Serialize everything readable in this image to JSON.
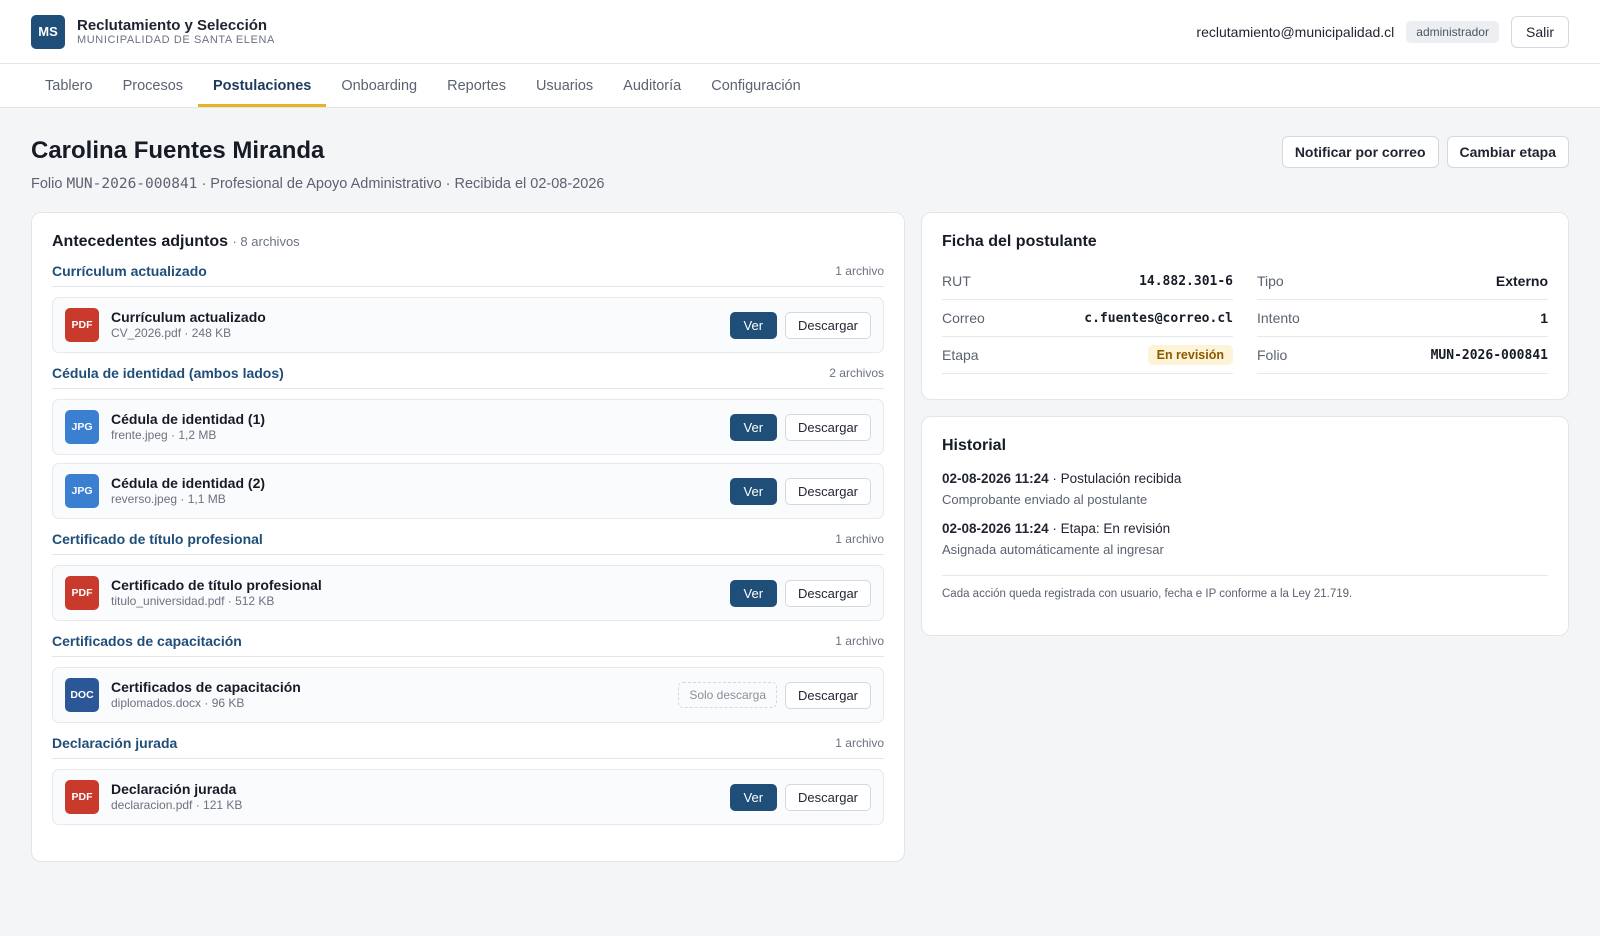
{
  "header": {
    "logo_text": "MS",
    "title": "Reclutamiento y Selección",
    "subtitle": "MUNICIPALIDAD DE SANTA ELENA",
    "user_email": "reclutamiento@municipalidad.cl",
    "role": "administrador",
    "logout_label": "Salir"
  },
  "nav": {
    "items": [
      "Tablero",
      "Procesos",
      "Postulaciones",
      "Onboarding",
      "Reportes",
      "Usuarios",
      "Auditoría",
      "Configuración"
    ],
    "active": "Postulaciones"
  },
  "page": {
    "title": "Carolina Fuentes Miranda",
    "meta_prefix": "Folio",
    "folio": "MUN-2026-000841",
    "meta_rest": "· Profesional de Apoyo Administrativo · Recibida el 02-08-2026",
    "actions": {
      "notify": "Notificar por correo",
      "change_stage": "Cambiar etapa"
    }
  },
  "attachments": {
    "title": "Antecedentes adjuntos",
    "count": "· 8 archivos",
    "view_label": "Ver",
    "download_label": "Descargar",
    "only_download_label": "Solo descarga",
    "groups": [
      {
        "name": "Currículum actualizado",
        "count": "1 archivo",
        "files": [
          {
            "type": "PDF",
            "color": "#c9392c",
            "name": "Currículum actualizado",
            "sub": "CV_2026.pdf · 248 KB",
            "viewable": true
          }
        ]
      },
      {
        "name": "Cédula de identidad (ambos lados)",
        "count": "2 archivos",
        "files": [
          {
            "type": "JPG",
            "color": "#3a7fd0",
            "name": "Cédula de identidad (1)",
            "sub": "frente.jpeg · 1,2 MB",
            "viewable": true
          },
          {
            "type": "JPG",
            "color": "#3a7fd0",
            "name": "Cédula de identidad (2)",
            "sub": "reverso.jpeg · 1,1 MB",
            "viewable": true
          }
        ]
      },
      {
        "name": "Certificado de título profesional",
        "count": "1 archivo",
        "files": [
          {
            "type": "PDF",
            "color": "#c9392c",
            "name": "Certificado de título profesional",
            "sub": "titulo_universidad.pdf · 512 KB",
            "viewable": true
          }
        ]
      },
      {
        "name": "Certificados de capacitación",
        "count": "1 archivo",
        "files": [
          {
            "type": "DOC",
            "color": "#2b5797",
            "name": "Certificados de capacitación",
            "sub": "diplomados.docx · 96 KB",
            "viewable": false
          }
        ]
      },
      {
        "name": "Declaración jurada",
        "count": "1 archivo",
        "files": [
          {
            "type": "PDF",
            "color": "#c9392c",
            "name": "Declaración jurada",
            "sub": "declaracion.pdf · 121 KB",
            "viewable": true
          }
        ]
      }
    ]
  },
  "ficha": {
    "title": "Ficha del postulante",
    "rut_label": "RUT",
    "rut": "14.882.301-6",
    "tipo_label": "Tipo",
    "tipo": "Externo",
    "correo_label": "Correo",
    "correo": "c.fuentes@correo.cl",
    "intento_label": "Intento",
    "intento": "1",
    "etapa_label": "Etapa",
    "etapa": "En revisión",
    "folio_label": "Folio",
    "folio": "MUN-2026-000841"
  },
  "historial": {
    "title": "Historial",
    "items": [
      {
        "when": "02-08-2026 11:24",
        "what": "· Postulación recibida",
        "note": "Comprobante enviado al postulante"
      },
      {
        "when": "02-08-2026 11:24",
        "what": "· Etapa: En revisión",
        "note": "Asignada automáticamente al ingresar"
      }
    ],
    "footer": "Cada acción queda registrada con usuario, fecha e IP conforme a la Ley 21.719."
  }
}
